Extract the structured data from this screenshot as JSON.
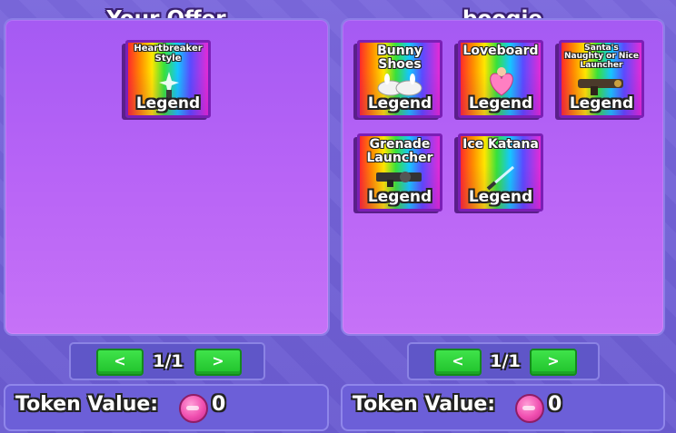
{
  "left": {
    "title": "Your Offer",
    "items": [
      {
        "name": "Heartbreaker Style",
        "rarity": "Legend"
      }
    ],
    "pager": {
      "prev": "<",
      "label": "1/1",
      "next": ">"
    },
    "token": {
      "label": "Token Value:",
      "value": "0"
    }
  },
  "right": {
    "title": "boogie",
    "items": [
      {
        "name": "Bunny Shoes",
        "rarity": "Legend"
      },
      {
        "name": "Loveboard",
        "rarity": "Legend"
      },
      {
        "name": "Santa's Naughty or Nice Launcher",
        "rarity": "Legend"
      },
      {
        "name": "Grenade Launcher",
        "rarity": "Legend"
      },
      {
        "name": "Ice Katana",
        "rarity": "Legend"
      }
    ],
    "pager": {
      "prev": "<",
      "label": "1/1",
      "next": ">"
    },
    "token": {
      "label": "Token Value:",
      "value": "0"
    }
  },
  "colors": {
    "panel": "#b864f6",
    "button": "#2fd23a",
    "coin": "#f04fb0"
  },
  "icons": [
    "token-coin-icon",
    "chevron-left-icon",
    "chevron-right-icon"
  ]
}
